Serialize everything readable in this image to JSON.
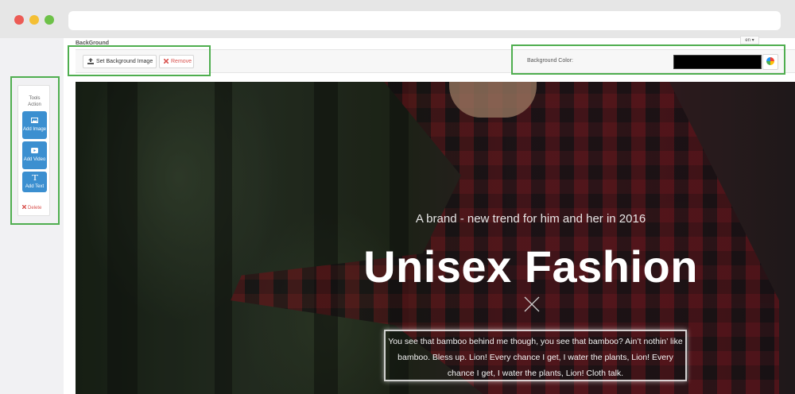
{
  "header": {
    "section_title": "BackGround",
    "lang_select": "en ▾"
  },
  "toolbar": {
    "set_bg_label": "Set Background Image",
    "remove_label": "Remove",
    "bg_color_label": "Background Color:",
    "bg_color_value": "#000000"
  },
  "tools": {
    "title_line1": "Tools",
    "title_line2": "Action",
    "add_image": "Add Image",
    "add_video": "Add Video",
    "add_text": "Add Text",
    "delete": "Delete"
  },
  "hero": {
    "subtitle": "A brand - new trend for him and her in 2016",
    "title": "Unisex Fashion",
    "body": "You see that bamboo behind me though, you see that bamboo? Ain’t nothin’ like bamboo. Bless up. Lion! Every chance I get, I water the plants, Lion! Every chance I get, I water the plants, Lion! Cloth talk."
  },
  "colors": {
    "highlight": "#4fae4f",
    "primary_button": "#3b8fd0",
    "danger": "#d9534f"
  },
  "icons": [
    "upload-icon",
    "close-icon",
    "color-wheel-icon",
    "image-icon",
    "video-icon",
    "text-icon",
    "x-divider-icon"
  ]
}
